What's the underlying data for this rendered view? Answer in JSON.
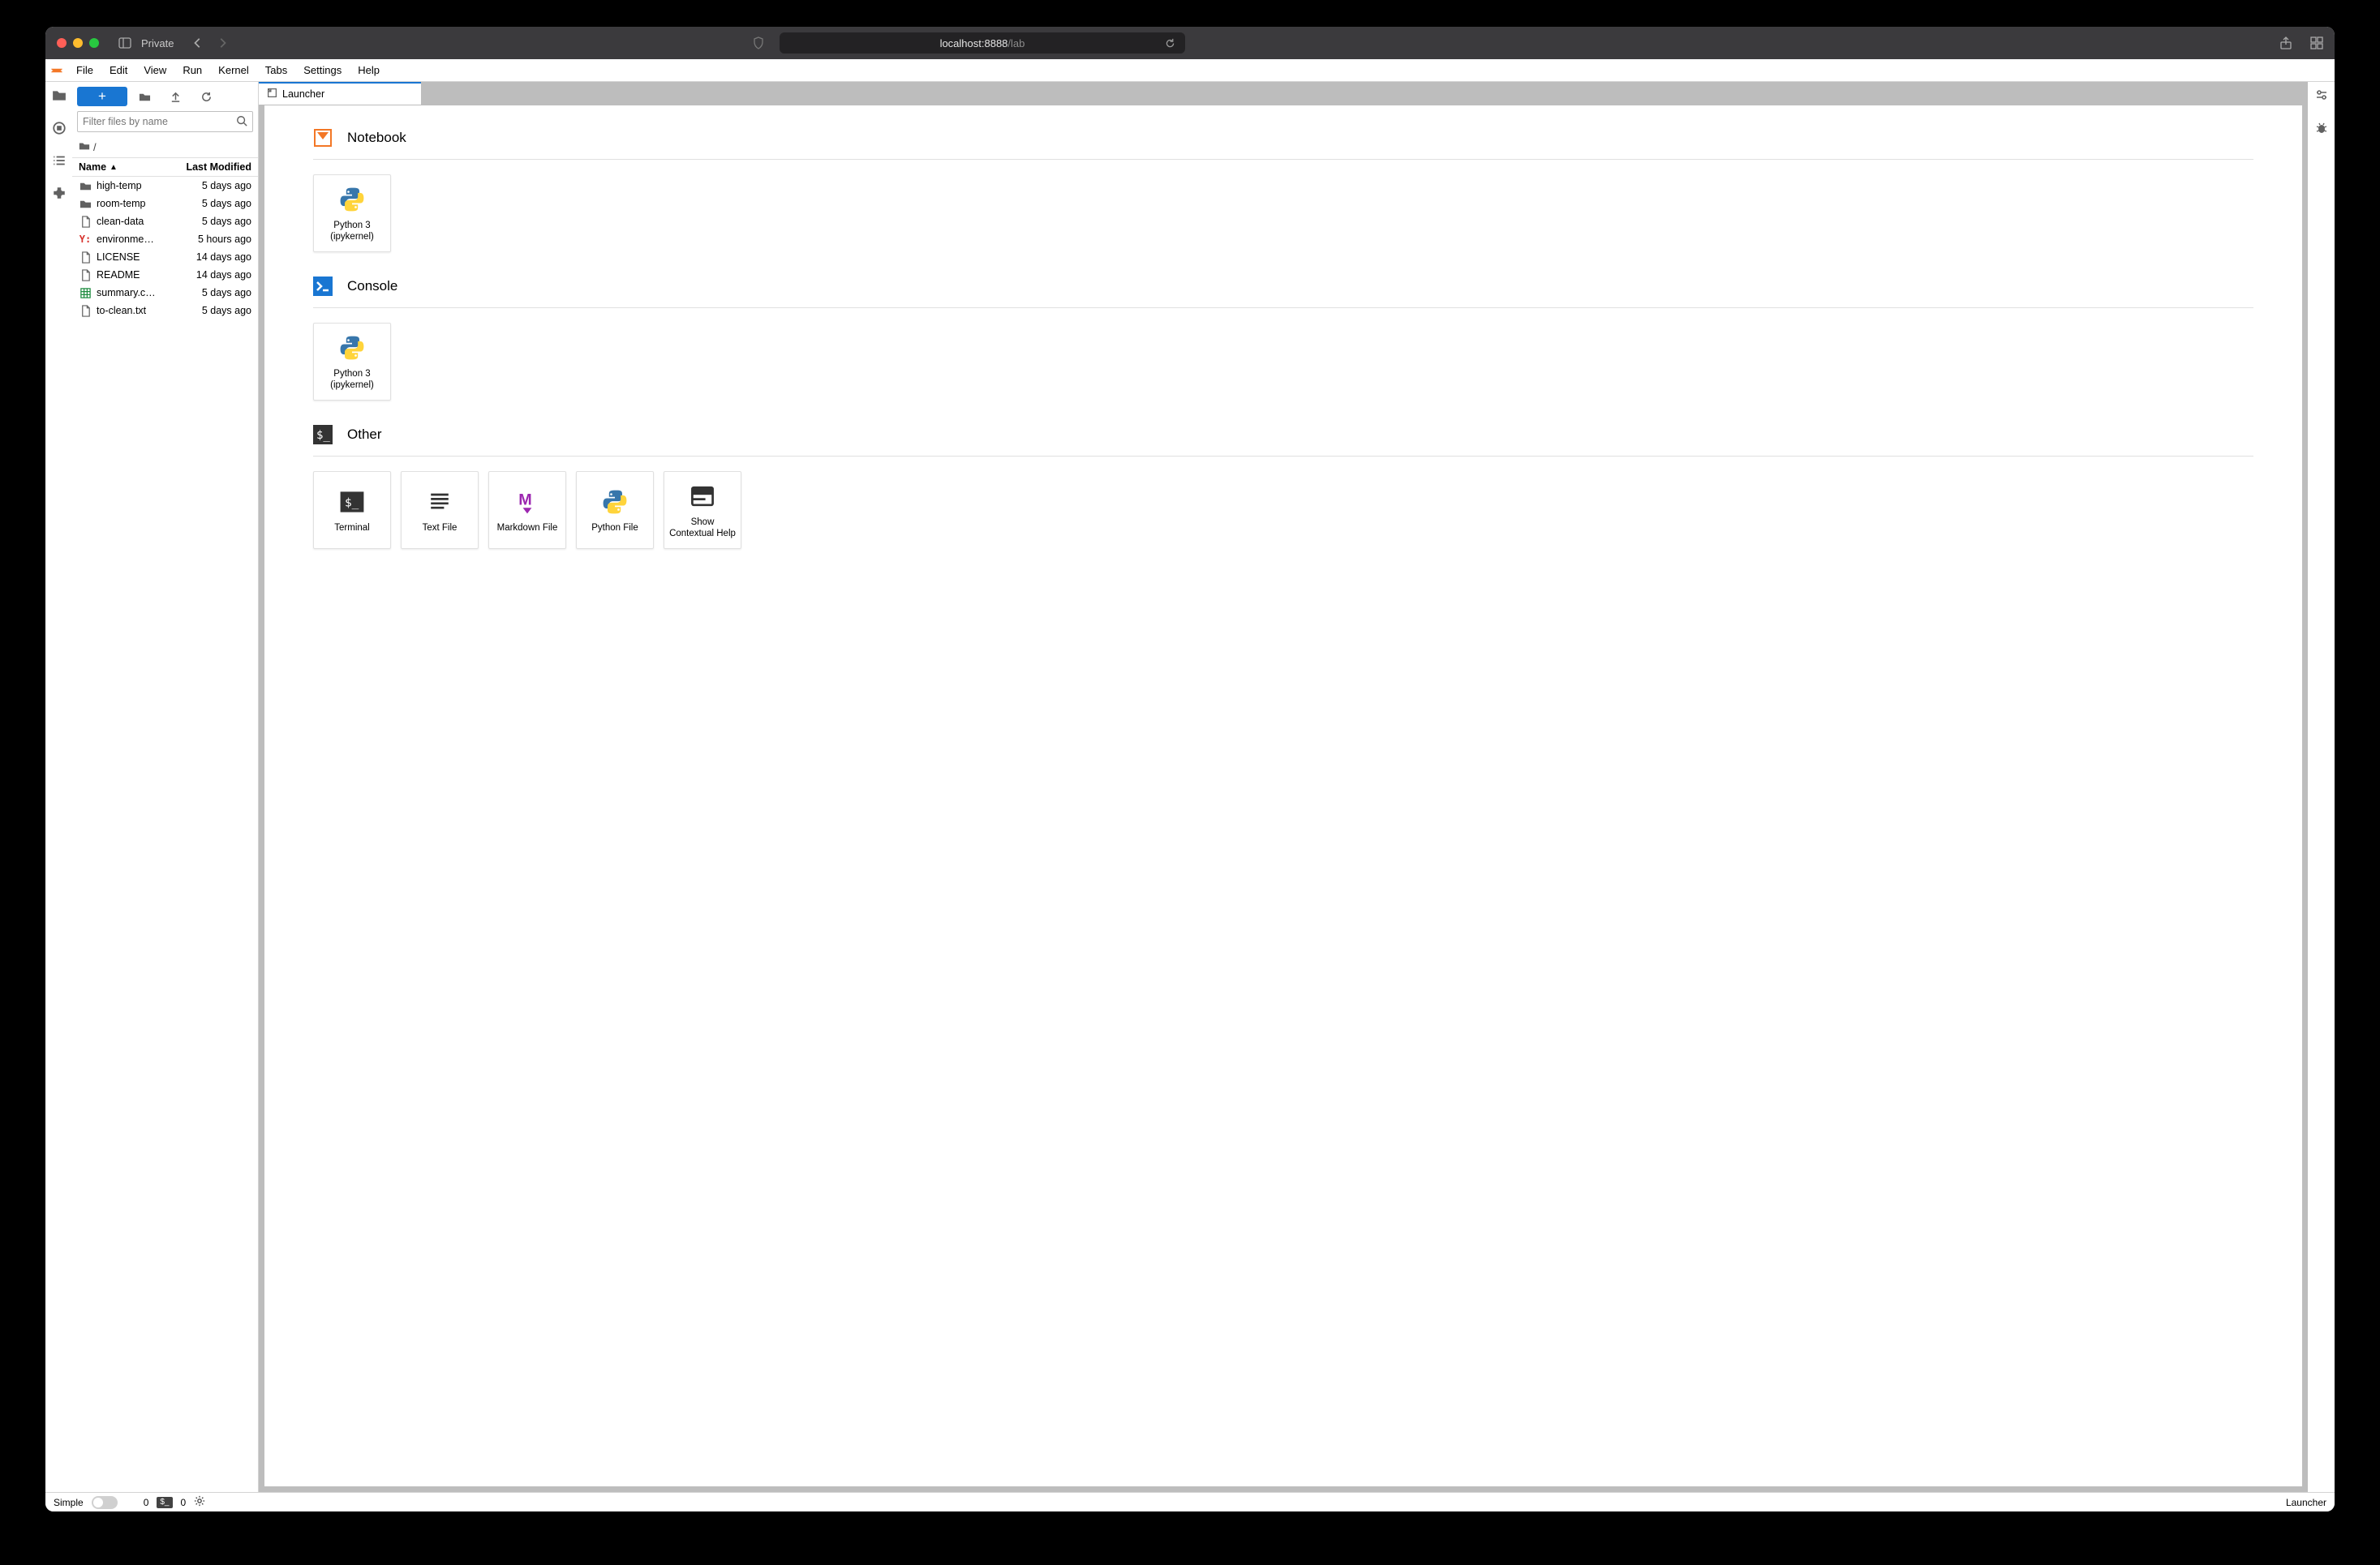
{
  "browser": {
    "private_label": "Private",
    "url_host": "localhost:8888",
    "url_path": "/lab"
  },
  "menu": [
    "File",
    "Edit",
    "View",
    "Run",
    "Kernel",
    "Tabs",
    "Settings",
    "Help"
  ],
  "filebrowser": {
    "filter_placeholder": "Filter files by name",
    "breadcrumb_root": "/",
    "headers": {
      "name": "Name",
      "modified": "Last Modified"
    },
    "items": [
      {
        "icon": "folder",
        "name": "high-temp",
        "modified": "5 days ago"
      },
      {
        "icon": "folder",
        "name": "room-temp",
        "modified": "5 days ago"
      },
      {
        "icon": "file",
        "name": "clean-data",
        "modified": "5 days ago"
      },
      {
        "icon": "yaml",
        "name": "environme…",
        "modified": "5 hours ago"
      },
      {
        "icon": "file",
        "name": "LICENSE",
        "modified": "14 days ago"
      },
      {
        "icon": "file",
        "name": "README",
        "modified": "14 days ago"
      },
      {
        "icon": "sheet",
        "name": "summary.c…",
        "modified": "5 days ago"
      },
      {
        "icon": "file",
        "name": "to-clean.txt",
        "modified": "5 days ago"
      }
    ]
  },
  "tabs": [
    {
      "label": "Launcher"
    }
  ],
  "launcher": {
    "sections": [
      {
        "key": "notebook",
        "label": "Notebook",
        "cards": [
          {
            "icon": "python",
            "label": "Python 3 (ipykernel)"
          }
        ]
      },
      {
        "key": "console",
        "label": "Console",
        "cards": [
          {
            "icon": "python",
            "label": "Python 3 (ipykernel)"
          }
        ]
      },
      {
        "key": "other",
        "label": "Other",
        "cards": [
          {
            "icon": "terminal",
            "label": "Terminal"
          },
          {
            "icon": "textfile",
            "label": "Text File"
          },
          {
            "icon": "markdown",
            "label": "Markdown File"
          },
          {
            "icon": "python",
            "label": "Python File"
          },
          {
            "icon": "help",
            "label": "Show Contextual Help"
          }
        ]
      }
    ]
  },
  "statusbar": {
    "simple_label": "Simple",
    "terminals_count": "0",
    "kernels_count": "0",
    "right_label": "Launcher"
  }
}
